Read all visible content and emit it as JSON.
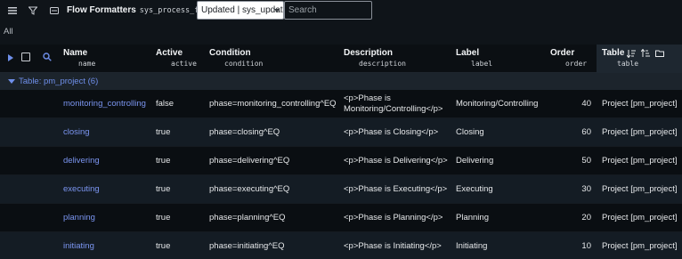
{
  "toolbar": {
    "title": "Flow Formatters",
    "table_name": "sys_process_flow",
    "filter_select_value": "Updated | sys_updat",
    "search_placeholder": "Search"
  },
  "breadcrumb": "All",
  "columns": [
    {
      "label": "Name",
      "field": "name"
    },
    {
      "label": "Active",
      "field": "active"
    },
    {
      "label": "Condition",
      "field": "condition"
    },
    {
      "label": "Description",
      "field": "description"
    },
    {
      "label": "Label",
      "field": "label"
    },
    {
      "label": "Order",
      "field": "order"
    },
    {
      "label": "Table",
      "field": "table"
    }
  ],
  "group": {
    "label": "Table: pm_project (6)"
  },
  "rows": [
    {
      "name": "monitoring_controlling",
      "active": "false",
      "condition": "phase=monitoring_controlling^EQ",
      "description": "<p>Phase is Monitoring/Controlling</p>",
      "label": "Monitoring/Controlling",
      "order": "40",
      "table": "Project [pm_project]"
    },
    {
      "name": "closing",
      "active": "true",
      "condition": "phase=closing^EQ",
      "description": "<p>Phase is Closing</p>",
      "label": "Closing",
      "order": "60",
      "table": "Project [pm_project]"
    },
    {
      "name": "delivering",
      "active": "true",
      "condition": "phase=delivering^EQ",
      "description": "<p>Phase is Delivering</p>",
      "label": "Delivering",
      "order": "50",
      "table": "Project [pm_project]"
    },
    {
      "name": "executing",
      "active": "true",
      "condition": "phase=executing^EQ",
      "description": "<p>Phase is Executing</p>",
      "label": "Executing",
      "order": "30",
      "table": "Project [pm_project]"
    },
    {
      "name": "planning",
      "active": "true",
      "condition": "phase=planning^EQ",
      "description": "<p>Phase is Planning</p>",
      "label": "Planning",
      "order": "20",
      "table": "Project [pm_project]"
    },
    {
      "name": "initiating",
      "active": "true",
      "condition": "phase=initiating^EQ",
      "description": "<p>Phase is Initiating</p>",
      "label": "Initiating",
      "order": "10",
      "table": "Project [pm_project]"
    }
  ]
}
